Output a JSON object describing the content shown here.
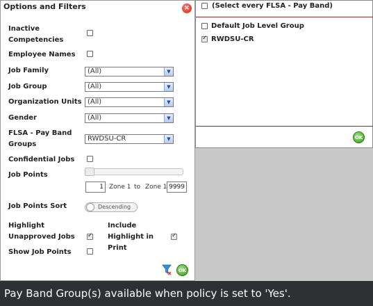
{
  "panel": {
    "title": "Options and Filters",
    "close_label": "×"
  },
  "fields": {
    "inactive_competencies": "Inactive Competencies",
    "employee_names": "Employee Names",
    "job_family": "Job Family",
    "job_group": "Job Group",
    "organization_units": "Organization Units",
    "gender": "Gender",
    "flsa_pay_band_groups": "FLSA - Pay Band Groups",
    "confidential_jobs": "Confidential Jobs",
    "job_points": "Job Points",
    "job_points_sort": "Job Points Sort",
    "highlight_unapproved_jobs": "Highlight Unapproved Jobs",
    "include_highlight_in_print": "Include Highlight in Print",
    "show_job_points": "Show Job Points"
  },
  "selects": {
    "job_family": "(All)",
    "job_group": "(All)",
    "organization_units": "(All)",
    "gender": "(All)",
    "flsa_pay_band_groups": "RWDSU-CR"
  },
  "job_points": {
    "from_value": "1",
    "from_zone": "Zone 1",
    "to_label": "to",
    "to_zone": "Zone 1",
    "to_value": "9999"
  },
  "job_points_sort": {
    "value": "Descending"
  },
  "checkbox_states": {
    "inactive_competencies": false,
    "employee_names": false,
    "confidential_jobs": false,
    "highlight_unapproved_jobs": true,
    "include_highlight_in_print": true,
    "show_job_points": false
  },
  "actions": {
    "ok_label": "OK"
  },
  "dropdown_panel": {
    "select_every": "(Select every FLSA - Pay Band)",
    "options": [
      {
        "label": "Default Job Level Group",
        "checked": false
      },
      {
        "label": "RWDSU-CR",
        "checked": true
      }
    ],
    "ok_label": "OK"
  },
  "caption": {
    "text": "Pay Band Group(s) available when policy is set to 'Yes'."
  },
  "colors": {
    "caption_bg": "#2f3033",
    "divider": "#8a2a2a",
    "ok_green": "#3c9a1f",
    "close_red": "#c8281a"
  }
}
